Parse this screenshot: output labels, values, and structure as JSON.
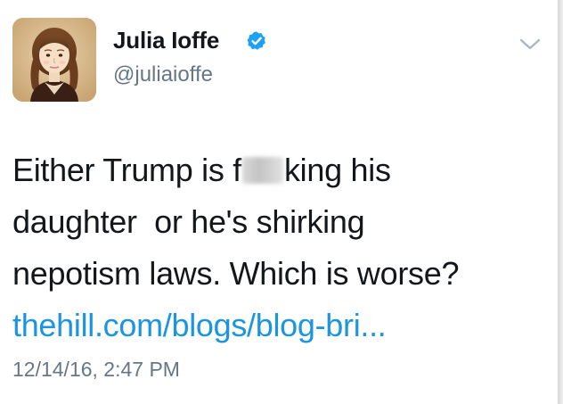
{
  "tweet": {
    "author": {
      "display_name": "Julia Ioffe",
      "handle": "@juliaioffe",
      "verified": true
    },
    "text_lines": [
      {
        "before": "Either Trump is f",
        "after": "king his"
      },
      "daughter  or he's shirking",
      "nepotism laws. Which is worse?"
    ],
    "link": "thehill.com/blogs/blog-bri...",
    "timestamp": "12/14/16, 2:47 PM"
  },
  "colors": {
    "text": "#14171a",
    "secondary": "#657786",
    "link": "#1b95e0",
    "verified_badge": "#1da1f2"
  },
  "icons": {
    "verified": "verified-badge-icon",
    "menu": "chevron-down-icon"
  }
}
